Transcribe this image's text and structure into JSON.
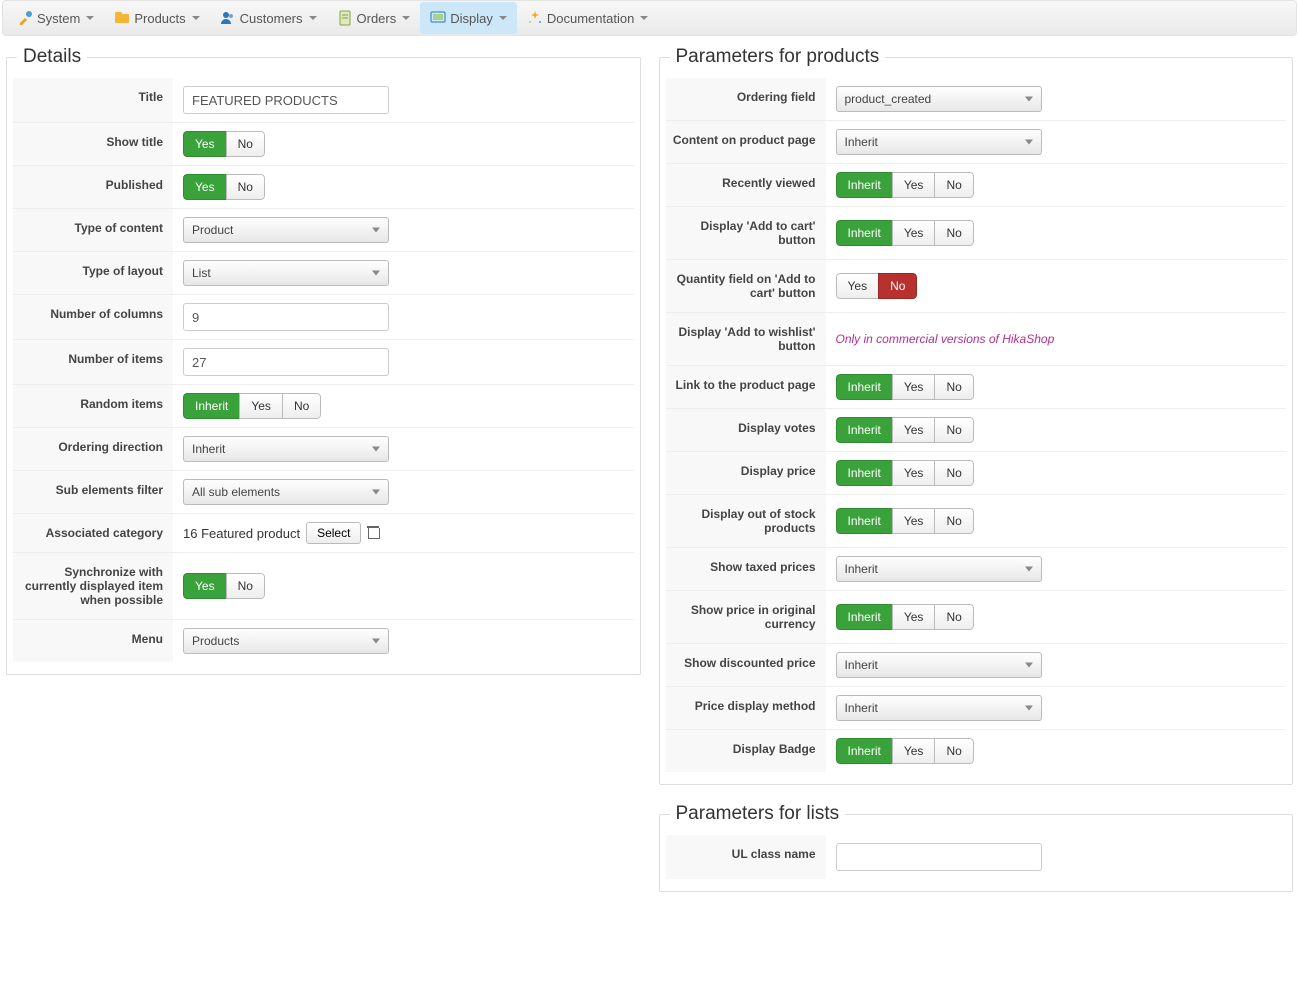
{
  "menu": {
    "items": [
      {
        "label": "System"
      },
      {
        "label": "Products"
      },
      {
        "label": "Customers"
      },
      {
        "label": "Orders"
      },
      {
        "label": "Display"
      },
      {
        "label": "Documentation"
      }
    ]
  },
  "common": {
    "inherit": "Inherit",
    "yes": "Yes",
    "no": "No"
  },
  "details": {
    "legend": "Details",
    "labels": {
      "title": "Title",
      "show_title": "Show title",
      "published": "Published",
      "type_content": "Type of content",
      "type_layout": "Type of layout",
      "num_columns": "Number of columns",
      "num_items": "Number of items",
      "random_items": "Random items",
      "ordering_direction": "Ordering direction",
      "sub_elements_filter": "Sub elements filter",
      "associated_category": "Associated category",
      "select_btn": "Select",
      "synchronize": "Synchronize with currently displayed item when possible",
      "menu": "Menu"
    },
    "values": {
      "title": "FEATURED PRODUCTS",
      "type_content": "Product",
      "type_layout": "List",
      "num_columns": "9",
      "num_items": "27",
      "ordering_direction": "Inherit",
      "sub_elements_filter": "All sub elements",
      "associated_category": "16 Featured product",
      "menu": "Products"
    }
  },
  "params_products": {
    "legend": "Parameters for products",
    "labels": {
      "ordering_field": "Ordering field",
      "content_on_product_page": "Content on product page",
      "recently_viewed": "Recently viewed",
      "display_add_to_cart": "Display 'Add to cart' button",
      "quantity_on_add_to_cart": "Quantity field on 'Add to cart' button",
      "display_add_to_wishlist": "Display 'Add to wishlist' button",
      "wishlist_note": "Only in commercial versions of HikaShop",
      "link_to_product_page": "Link to the product page",
      "display_votes": "Display votes",
      "display_price": "Display price",
      "display_out_of_stock": "Display out of stock products",
      "show_taxed_prices": "Show taxed prices",
      "show_price_original_currency": "Show price in original currency",
      "show_discounted_price": "Show discounted price",
      "price_display_method": "Price display method",
      "display_badge": "Display Badge"
    },
    "values": {
      "ordering_field": "product_created",
      "content_on_product_page": "Inherit",
      "show_taxed_prices": "Inherit",
      "show_discounted_price": "Inherit",
      "price_display_method": "Inherit"
    }
  },
  "params_lists": {
    "legend": "Parameters for lists",
    "labels": {
      "ul_class_name": "UL class name"
    },
    "values": {
      "ul_class_name": ""
    }
  }
}
